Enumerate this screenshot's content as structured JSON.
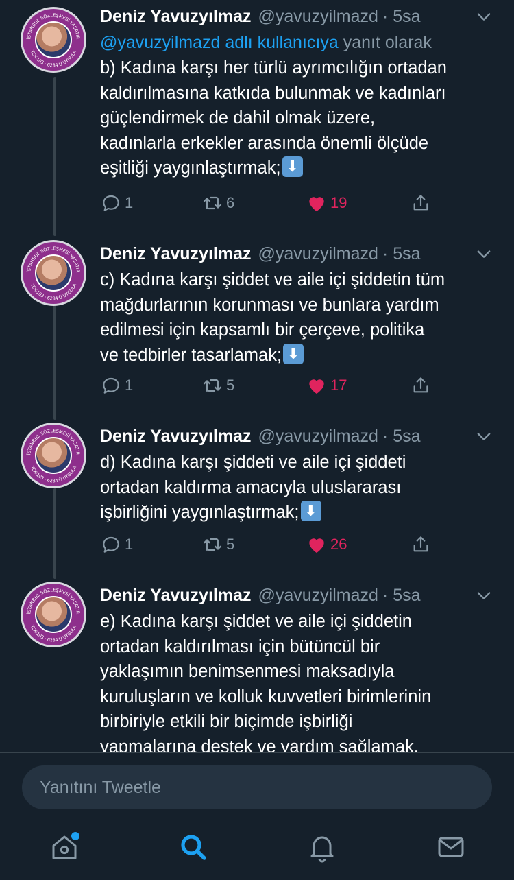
{
  "tweets": [
    {
      "name": "Deniz Yavuzyılmaz",
      "handle": "@yavuzyilmazd",
      "time": "· 5sa",
      "reply_to_mention": "@yavuzyilmazd adlı kullanıcıya",
      "reply_to_suffix": " yanıt olarak",
      "text": "b) Kadına karşı her türlü ayrımcılığın ortadan\nkaldırılmasına katkıda bulunmak ve kadınları\ngüçlendirmek de dahil olmak üzere,\nkadınlarla erkekler arasında önemli ölçüde\neşitliği yaygınlaştırmak;",
      "replies": "1",
      "retweets": "6",
      "likes": "19"
    },
    {
      "name": "Deniz Yavuzyılmaz",
      "handle": "@yavuzyilmazd",
      "time": "· 5sa",
      "text": "c) Kadına karşı şiddet ve aile içi şiddetin tüm\nmağdurlarının korunması ve bunlara yardım\nedilmesi için kapsamlı bir çerçeve, politika\nve tedbirler tasarlamak;",
      "replies": "1",
      "retweets": "5",
      "likes": "17"
    },
    {
      "name": "Deniz Yavuzyılmaz",
      "handle": "@yavuzyilmazd",
      "time": "· 5sa",
      "text": "d) Kadına karşı şiddeti ve aile içi şiddeti\nortadan kaldırma amacıyla uluslararası\nişbirliğini yaygınlaştırmak;",
      "replies": "1",
      "retweets": "5",
      "likes": "26"
    },
    {
      "name": "Deniz Yavuzyılmaz",
      "handle": "@yavuzyilmazd",
      "time": "· 5sa",
      "text": "e) Kadına karşı şiddet ve aile içi şiddetin\nortadan kaldırılması için bütüncül bir\nyaklaşımın benimsenmesi maksadıyla\nkuruluşların ve kolluk kuvvetleri birimlerinin\nbirbiriyle etkili bir biçimde işbirliği\nyapmalarına destek ve yardım sağlamak."
    }
  ],
  "avatar_ring_top": "İSTANBUL SÖZLEŞMESİ YAŞATIR",
  "avatar_ring_bottom": "TCK-103 · 6284'Ü UYGULA",
  "reply_placeholder": "Yanıtını Tweetle",
  "colors": {
    "background": "#15202b",
    "accent": "#1da1f2",
    "like": "#e0245e",
    "muted": "#8899a6"
  },
  "icons": [
    "chevron-down-icon",
    "reply-icon",
    "retweet-icon",
    "heart-icon",
    "share-icon",
    "home-icon",
    "search-icon",
    "bell-icon",
    "mail-icon"
  ]
}
